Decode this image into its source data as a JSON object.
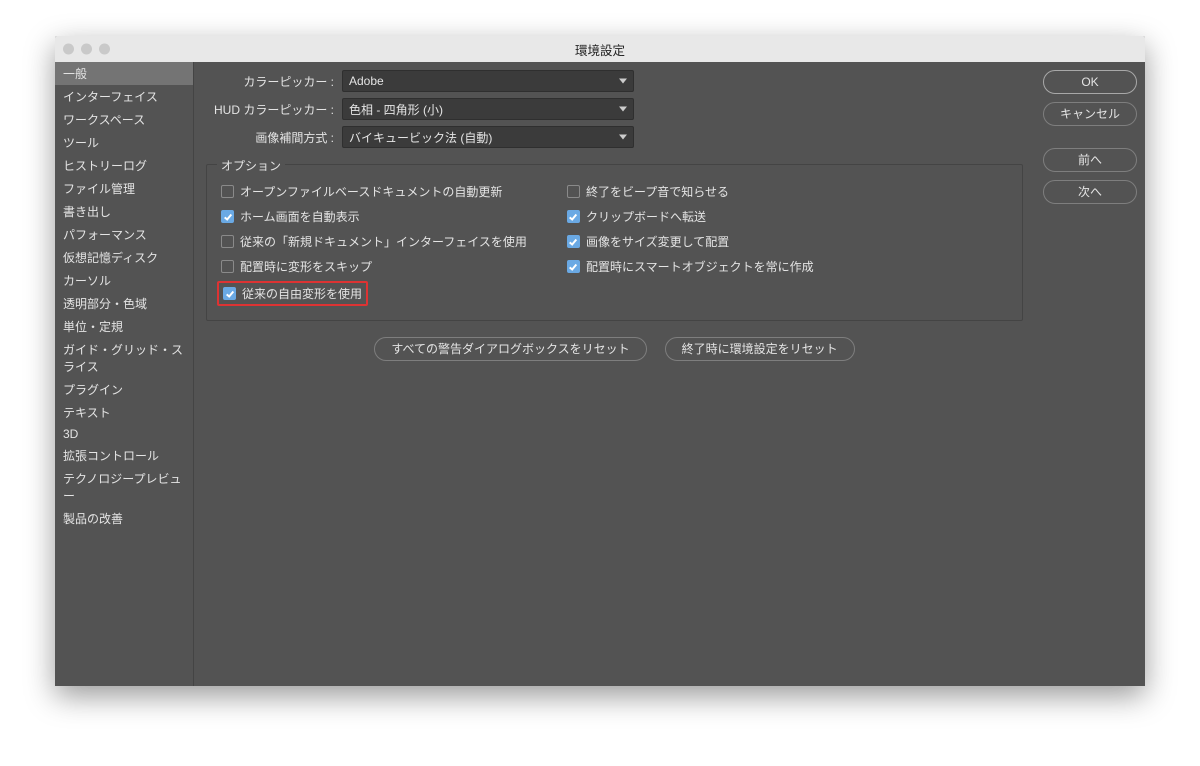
{
  "dialog_title": "環境設定",
  "sidebar": {
    "items": [
      {
        "label": "一般",
        "selected": true
      },
      {
        "label": "インターフェイス"
      },
      {
        "label": "ワークスペース"
      },
      {
        "label": "ツール"
      },
      {
        "label": "ヒストリーログ"
      },
      {
        "label": "ファイル管理"
      },
      {
        "label": "書き出し"
      },
      {
        "label": "パフォーマンス"
      },
      {
        "label": "仮想記憶ディスク"
      },
      {
        "label": "カーソル"
      },
      {
        "label": "透明部分・色域"
      },
      {
        "label": "単位・定規"
      },
      {
        "label": "ガイド・グリッド・スライス"
      },
      {
        "label": "プラグイン"
      },
      {
        "label": "テキスト"
      },
      {
        "label": "3D"
      },
      {
        "label": "拡張コントロール"
      },
      {
        "label": "テクノロジープレビュー"
      },
      {
        "label": "製品の改善"
      }
    ]
  },
  "form": {
    "color_picker": {
      "label": "カラーピッカー :",
      "value": "Adobe"
    },
    "hud_picker": {
      "label": "HUD カラーピッカー :",
      "value": "色相 - 四角形 (小)"
    },
    "interp": {
      "label": "画像補間方式 :",
      "value": "バイキュービック法 (自動)"
    }
  },
  "options": {
    "title": "オプション",
    "left": [
      {
        "label": "オープンファイルベースドキュメントの自動更新",
        "checked": false
      },
      {
        "label": "ホーム画面を自動表示",
        "checked": true
      },
      {
        "label": "従来の「新規ドキュメント」インターフェイスを使用",
        "checked": false
      },
      {
        "label": "配置時に変形をスキップ",
        "checked": false
      },
      {
        "label": "従来の自由変形を使用",
        "checked": true,
        "highlight": true
      }
    ],
    "right": [
      {
        "label": "終了をビープ音で知らせる",
        "checked": false
      },
      {
        "label": "クリップボードへ転送",
        "checked": true
      },
      {
        "label": "画像をサイズ変更して配置",
        "checked": true
      },
      {
        "label": "配置時にスマートオブジェクトを常に作成",
        "checked": true
      }
    ]
  },
  "reset": {
    "all_warnings": "すべての警告ダイアログボックスをリセット",
    "on_quit": "終了時に環境設定をリセット"
  },
  "buttons": {
    "ok": "OK",
    "cancel": "キャンセル",
    "prev": "前へ",
    "next": "次へ"
  }
}
